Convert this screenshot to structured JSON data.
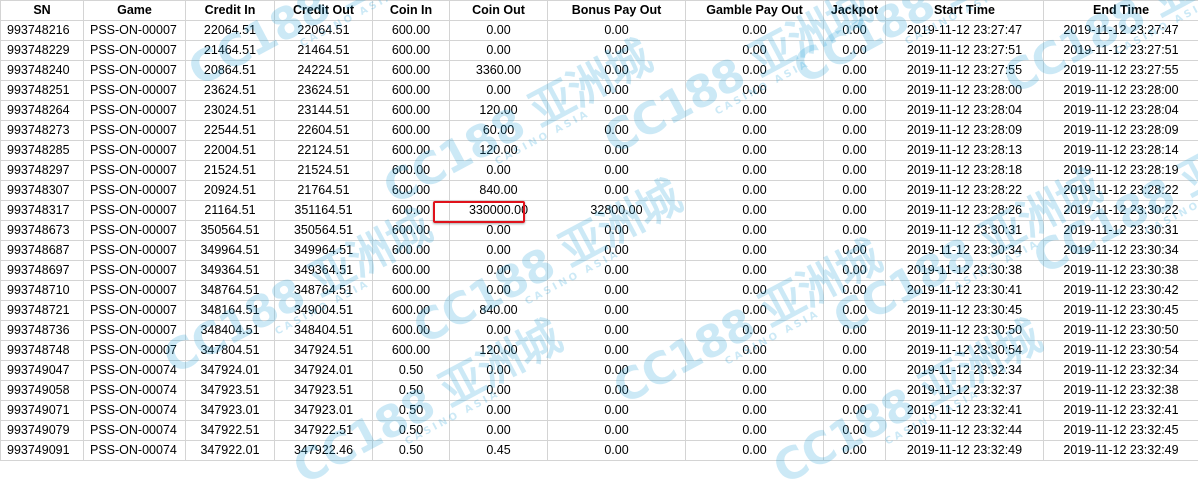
{
  "columns": [
    "SN",
    "Game",
    "Credit In",
    "Credit Out",
    "Coin In",
    "Coin Out",
    "Bonus Pay Out",
    "Gamble Pay Out",
    "Jackpot",
    "Start Time",
    "End Time"
  ],
  "rows": [
    [
      "993748216",
      "PSS-ON-00007",
      "22064.51",
      "22064.51",
      "600.00",
      "0.00",
      "0.00",
      "0.00",
      "0.00",
      "2019-11-12 23:27:47",
      "2019-11-12 23:27:47"
    ],
    [
      "993748229",
      "PSS-ON-00007",
      "21464.51",
      "21464.51",
      "600.00",
      "0.00",
      "0.00",
      "0.00",
      "0.00",
      "2019-11-12 23:27:51",
      "2019-11-12 23:27:51"
    ],
    [
      "993748240",
      "PSS-ON-00007",
      "20864.51",
      "24224.51",
      "600.00",
      "3360.00",
      "0.00",
      "0.00",
      "0.00",
      "2019-11-12 23:27:55",
      "2019-11-12 23:27:55"
    ],
    [
      "993748251",
      "PSS-ON-00007",
      "23624.51",
      "23624.51",
      "600.00",
      "0.00",
      "0.00",
      "0.00",
      "0.00",
      "2019-11-12 23:28:00",
      "2019-11-12 23:28:00"
    ],
    [
      "993748264",
      "PSS-ON-00007",
      "23024.51",
      "23144.51",
      "600.00",
      "120.00",
      "0.00",
      "0.00",
      "0.00",
      "2019-11-12 23:28:04",
      "2019-11-12 23:28:04"
    ],
    [
      "993748273",
      "PSS-ON-00007",
      "22544.51",
      "22604.51",
      "600.00",
      "60.00",
      "0.00",
      "0.00",
      "0.00",
      "2019-11-12 23:28:09",
      "2019-11-12 23:28:09"
    ],
    [
      "993748285",
      "PSS-ON-00007",
      "22004.51",
      "22124.51",
      "600.00",
      "120.00",
      "0.00",
      "0.00",
      "0.00",
      "2019-11-12 23:28:13",
      "2019-11-12 23:28:14"
    ],
    [
      "993748297",
      "PSS-ON-00007",
      "21524.51",
      "21524.51",
      "600.00",
      "0.00",
      "0.00",
      "0.00",
      "0.00",
      "2019-11-12 23:28:18",
      "2019-11-12 23:28:19"
    ],
    [
      "993748307",
      "PSS-ON-00007",
      "20924.51",
      "21764.51",
      "600.00",
      "840.00",
      "0.00",
      "0.00",
      "0.00",
      "2019-11-12 23:28:22",
      "2019-11-12 23:28:22"
    ],
    [
      "993748317",
      "PSS-ON-00007",
      "21164.51",
      "351164.51",
      "600.00",
      "330000.00",
      "32800.00",
      "0.00",
      "0.00",
      "2019-11-12 23:28:26",
      "2019-11-12 23:30:22"
    ],
    [
      "993748673",
      "PSS-ON-00007",
      "350564.51",
      "350564.51",
      "600.00",
      "0.00",
      "0.00",
      "0.00",
      "0.00",
      "2019-11-12 23:30:31",
      "2019-11-12 23:30:31"
    ],
    [
      "993748687",
      "PSS-ON-00007",
      "349964.51",
      "349964.51",
      "600.00",
      "0.00",
      "0.00",
      "0.00",
      "0.00",
      "2019-11-12 23:30:34",
      "2019-11-12 23:30:34"
    ],
    [
      "993748697",
      "PSS-ON-00007",
      "349364.51",
      "349364.51",
      "600.00",
      "0.00",
      "0.00",
      "0.00",
      "0.00",
      "2019-11-12 23:30:38",
      "2019-11-12 23:30:38"
    ],
    [
      "993748710",
      "PSS-ON-00007",
      "348764.51",
      "348764.51",
      "600.00",
      "0.00",
      "0.00",
      "0.00",
      "0.00",
      "2019-11-12 23:30:41",
      "2019-11-12 23:30:42"
    ],
    [
      "993748721",
      "PSS-ON-00007",
      "348164.51",
      "349004.51",
      "600.00",
      "840.00",
      "0.00",
      "0.00",
      "0.00",
      "2019-11-12 23:30:45",
      "2019-11-12 23:30:45"
    ],
    [
      "993748736",
      "PSS-ON-00007",
      "348404.51",
      "348404.51",
      "600.00",
      "0.00",
      "0.00",
      "0.00",
      "0.00",
      "2019-11-12 23:30:50",
      "2019-11-12 23:30:50"
    ],
    [
      "993748748",
      "PSS-ON-00007",
      "347804.51",
      "347924.51",
      "600.00",
      "120.00",
      "0.00",
      "0.00",
      "0.00",
      "2019-11-12 23:30:54",
      "2019-11-12 23:30:54"
    ],
    [
      "993749047",
      "PSS-ON-00074",
      "347924.01",
      "347924.01",
      "0.50",
      "0.00",
      "0.00",
      "0.00",
      "0.00",
      "2019-11-12 23:32:34",
      "2019-11-12 23:32:34"
    ],
    [
      "993749058",
      "PSS-ON-00074",
      "347923.51",
      "347923.51",
      "0.50",
      "0.00",
      "0.00",
      "0.00",
      "0.00",
      "2019-11-12 23:32:37",
      "2019-11-12 23:32:38"
    ],
    [
      "993749071",
      "PSS-ON-00074",
      "347923.01",
      "347923.01",
      "0.50",
      "0.00",
      "0.00",
      "0.00",
      "0.00",
      "2019-11-12 23:32:41",
      "2019-11-12 23:32:41"
    ],
    [
      "993749079",
      "PSS-ON-00074",
      "347922.51",
      "347922.51",
      "0.50",
      "0.00",
      "0.00",
      "0.00",
      "0.00",
      "2019-11-12 23:32:44",
      "2019-11-12 23:32:45"
    ],
    [
      "993749091",
      "PSS-ON-00074",
      "347922.01",
      "347922.46",
      "0.50",
      "0.45",
      "0.00",
      "0.00",
      "0.00",
      "2019-11-12 23:32:49",
      "2019-11-12 23:32:49"
    ]
  ],
  "highlight": {
    "row": 9,
    "col": 5,
    "color": "#e0121b"
  },
  "watermark": {
    "text": "CC188 亚洲城",
    "sub": "CASINO ASIA",
    "color": "#1e9fd8"
  }
}
